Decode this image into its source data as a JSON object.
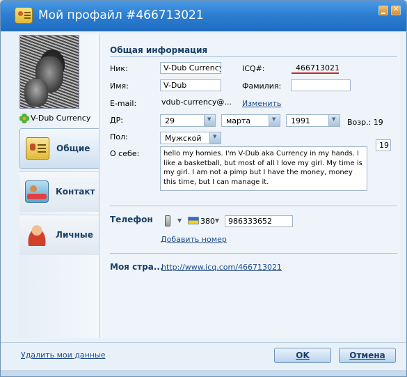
{
  "window": {
    "title": "Мой профайл #466713021"
  },
  "sidebar": {
    "nickname": "V-Dub Currency",
    "items": [
      {
        "label": "Общие",
        "icon": "id-card-icon",
        "active": true
      },
      {
        "label": "Контакт",
        "icon": "contact-card-icon",
        "active": false
      },
      {
        "label": "Личные",
        "icon": "person-icon",
        "active": false
      }
    ],
    "delete_link": "Удалить мои данные"
  },
  "general": {
    "section_title": "Общая информация",
    "nick_label": "Ник:",
    "nick_value": "V-Dub Currency",
    "icq_label": "ICQ#:",
    "icq_value": "466713021",
    "name_label": "Имя:",
    "name_value": "V-Dub",
    "surname_label": "Фамилия:",
    "surname_value": "",
    "email_label": "E-mail:",
    "email_value": "vdub-currency@...",
    "email_change_link": "Изменить",
    "dob_label": "ДР:",
    "dob_day": "29",
    "dob_month": "марта",
    "dob_year": "1991",
    "age_label": "Возр.: 19",
    "gender_label": "Пол:",
    "gender_value": "Мужской",
    "about_label": "О себе:",
    "about_text": "hello my homies. I'm V-Dub aka Currency in my hands. I like a basketball, but most of all I love my girl. My time is my girl. I am not a pimp but I have the money, money this time, but I can manage it.",
    "about_counter": "19"
  },
  "phone": {
    "section_title": "Телефон",
    "country_code": "380",
    "number": "986333652",
    "add_link": "Добавить номер"
  },
  "page": {
    "section_title": "Моя стра...",
    "url": "http://www.icq.com/466713021"
  },
  "buttons": {
    "ok": "OK",
    "cancel": "Отмена"
  },
  "colors": {
    "titlebar": "#2d7fd2",
    "accent_text": "#1b3f66",
    "link": "#1e4b8a",
    "icq_underline": "#c8262a"
  }
}
